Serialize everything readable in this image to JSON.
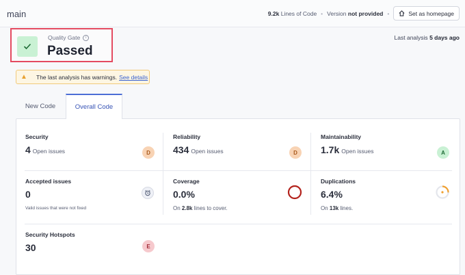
{
  "header": {
    "branch": "main",
    "loc_value": "9.2k",
    "loc_label": "Lines of Code",
    "version_label": "Version",
    "version_value": "not provided",
    "home_button": "Set as homepage"
  },
  "quality_gate": {
    "label": "Quality Gate",
    "status": "Passed"
  },
  "analysis": {
    "label": "Last analysis",
    "value": "5 days ago"
  },
  "warning": {
    "text": "The last analysis has warnings.",
    "link": "See details"
  },
  "tabs": [
    {
      "label": "New Code",
      "active": false
    },
    {
      "label": "Overall Code",
      "active": true
    }
  ],
  "measures": {
    "security": {
      "title": "Security",
      "value": "4",
      "suffix": "Open issues",
      "rating": "D"
    },
    "reliability": {
      "title": "Reliability",
      "value": "434",
      "suffix": "Open issues",
      "rating": "D"
    },
    "maintainability": {
      "title": "Maintainability",
      "value": "1.7k",
      "suffix": "Open issues",
      "rating": "A"
    },
    "accepted": {
      "title": "Accepted issues",
      "value": "0",
      "sub": "Valid issues that were not fixed"
    },
    "coverage": {
      "title": "Coverage",
      "value": "0.0%",
      "sub_prefix": "On",
      "sub_bold": "2.8k",
      "sub_suffix": "lines to cover.",
      "percent": 0.0
    },
    "duplications": {
      "title": "Duplications",
      "value": "6.4%",
      "sub_prefix": "On",
      "sub_bold": "13k",
      "sub_suffix": "lines.",
      "percent": 6.4
    },
    "hotspots": {
      "title": "Security Hotspots",
      "value": "30",
      "rating": "E"
    }
  },
  "colors": {
    "rating_D_bg": "#f8d3b4",
    "rating_D_fg": "#a8581b",
    "rating_A_bg": "#c9f1d4",
    "rating_A_fg": "#1d6b35",
    "rating_E_bg": "#f6c9cd",
    "rating_E_fg": "#a12a37",
    "coverage_ring": "#b3221c",
    "duplication_ring": "#f0a030",
    "accent": "#4c6ed6"
  }
}
